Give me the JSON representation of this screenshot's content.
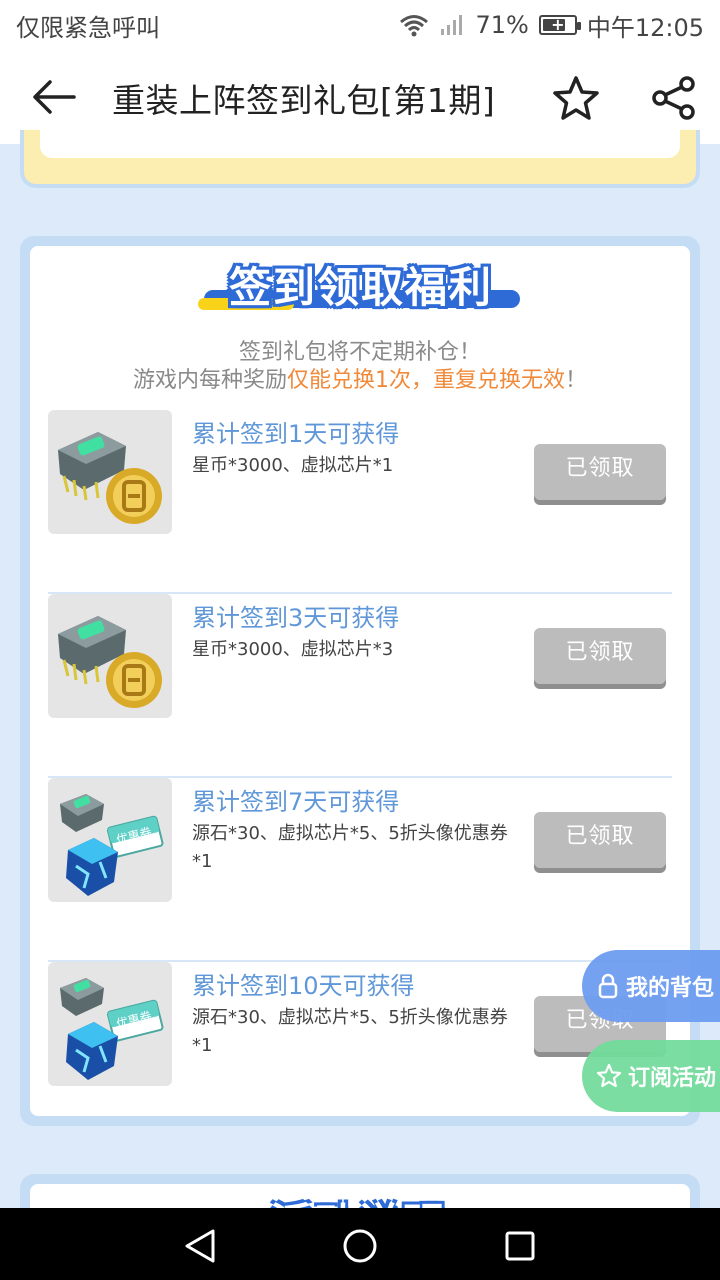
{
  "status_bar": {
    "carrier": "仅限紧急呼叫",
    "battery": "71%",
    "time": "中午12:05"
  },
  "header": {
    "title": "重装上阵签到礼包[第1期]"
  },
  "welfare": {
    "title": "签到领取福利",
    "notice_line1": "签到礼包将不定期补仓！",
    "notice_line2_prefix": "游戏内每种奖励",
    "notice_line2_highlight": "仅能兑换1次，重复兑换无效",
    "notice_line2_suffix": "！",
    "rewards": [
      {
        "title": "累计签到1天可获得",
        "desc": "星币*3000、虚拟芯片*1",
        "button": "已领取"
      },
      {
        "title": "累计签到3天可获得",
        "desc": "星币*3000、虚拟芯片*3",
        "button": "已领取"
      },
      {
        "title": "累计签到7天可获得",
        "desc": "源石*30、虚拟芯片*5、5折头像优惠券*1",
        "button": "已领取"
      },
      {
        "title": "累计签到10天可获得",
        "desc": "源石*30、虚拟芯片*5、5折头像优惠券*1",
        "button": "已领取"
      }
    ],
    "coupon_label": "优惠券"
  },
  "next_section_title": "活动说明",
  "floating": {
    "bag": "我的背包",
    "subscribe": "订阅活动"
  },
  "colors": {
    "accent_blue": "#2e6bd6",
    "title_blue": "#5f97d8",
    "highlight_orange": "#f08a3a",
    "claimed_gray": "#bcbcbc"
  }
}
